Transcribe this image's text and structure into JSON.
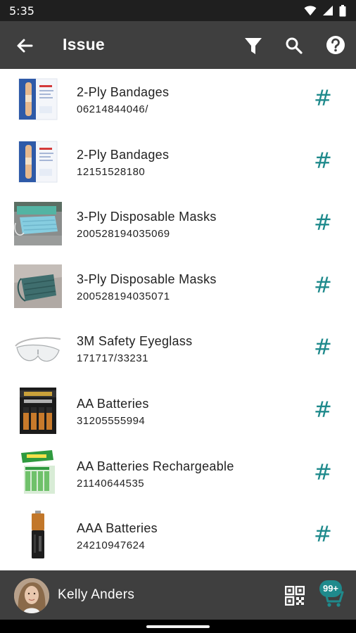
{
  "status_bar": {
    "time": "5:35"
  },
  "app_bar": {
    "title": "Issue",
    "icons": [
      "back-arrow-icon",
      "filter-icon",
      "search-icon",
      "help-icon"
    ]
  },
  "items": [
    {
      "name": "2-Ply Bandages",
      "code": "06214844046/",
      "thumb": "bandages-box",
      "action": "#"
    },
    {
      "name": "2-Ply Bandages",
      "code": "12151528180",
      "thumb": "bandages-box",
      "action": "#"
    },
    {
      "name": "3-Ply Disposable Masks",
      "code": "200528194035069",
      "thumb": "masks-photo",
      "action": "#"
    },
    {
      "name": "3-Ply Disposable Masks",
      "code": "200528194035071",
      "thumb": "mask-photo-dark",
      "action": "#"
    },
    {
      "name": "3M Safety Eyeglass",
      "code": "171717/33231",
      "thumb": "safety-eyeglass",
      "action": "#"
    },
    {
      "name": "AA Batteries",
      "code": "31205555994",
      "thumb": "aa-batteries-duracell",
      "action": "#"
    },
    {
      "name": "AA Batteries Rechargeable",
      "code": "21140644535",
      "thumb": "aa-batteries-energizer",
      "action": "#"
    },
    {
      "name": "AAA Batteries",
      "code": "24210947624",
      "thumb": "aaa-battery",
      "action": "#"
    }
  ],
  "user_bar": {
    "user_name": "Kelly Anders",
    "cart_badge": "99+"
  },
  "colors": {
    "app_bar": "#3f3f3f",
    "status_bar": "#1f1f1f",
    "accent": "#1f8a8c"
  }
}
